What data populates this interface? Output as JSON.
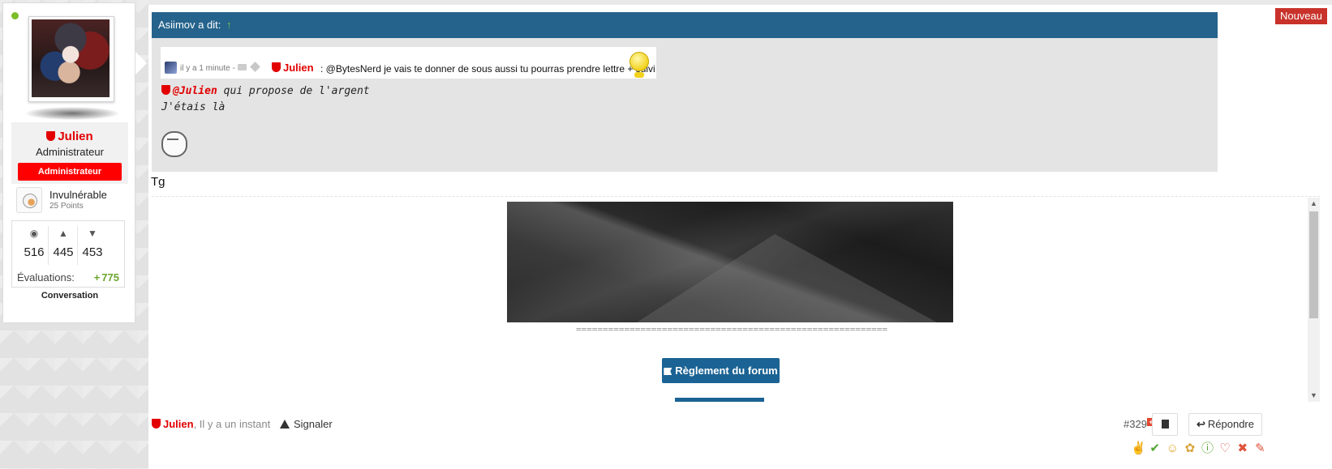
{
  "user": {
    "name": "Julien",
    "title": "Administrateur",
    "role_badge": "Administrateur",
    "online_color": "#7cbd2b",
    "name_color": "#e20000",
    "trophy": {
      "name": "Invulnérable",
      "points": "25 Points"
    },
    "stats": [
      {
        "icon": "comments-icon",
        "value": "516"
      },
      {
        "icon": "thumbs-up-icon",
        "value": "445"
      },
      {
        "icon": "trophy-icon",
        "value": "453"
      }
    ],
    "evaluations_label": "Évaluations:",
    "evaluations_value": "775",
    "conversation_label": "Conversation"
  },
  "post": {
    "new_badge": "Nouveau",
    "quote": {
      "header": "Asiimov a dit:",
      "up_arrow": "↑",
      "chat_time": "il y a 1 minute -",
      "chat_user": "Julien",
      "chat_text": ": @BytesNerd je vais te donner de sous aussi tu pourras prendre lettre + suivi",
      "mention": "@Julien",
      "line1_rest": " qui propose de l'argent",
      "line2": "J'étais là"
    },
    "body_text": "Tg",
    "signature": {
      "separator": "==========================================================",
      "rules_button": "Règlement du forum"
    },
    "footer": {
      "author": "Julien",
      "time": ", Il y a un instant",
      "report": "Signaler",
      "post_number": "#329",
      "reply": "Répondre"
    },
    "reactions": [
      "like-icon",
      "check-icon",
      "smile-icon",
      "award-icon",
      "info-icon",
      "heart-icon",
      "cross-icon",
      "pencil-icon"
    ]
  },
  "colors": {
    "quote_header": "#25638c",
    "rules_button": "#1b6394",
    "new_badge": "#c8322b",
    "admin_badge": "#ff0000"
  }
}
